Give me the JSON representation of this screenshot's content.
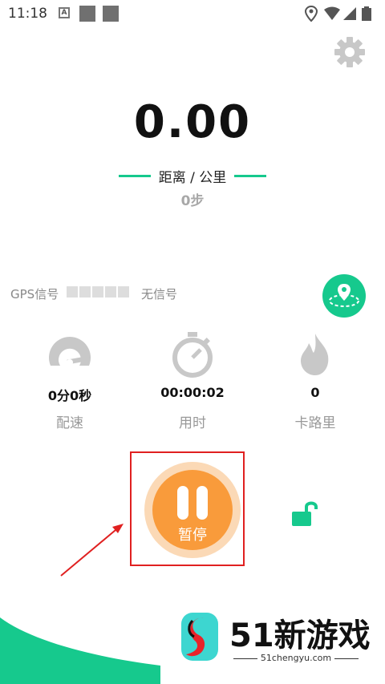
{
  "statusbar": {
    "time": "11:18",
    "a_badge": "A",
    "icons": [
      "location-icon",
      "wifi-icon",
      "signal-icon",
      "battery-icon"
    ]
  },
  "run": {
    "distance": "0.00",
    "distance_unit": "距离 / 公里",
    "steps": "0步"
  },
  "gps": {
    "label": "GPS信号",
    "signal_level": 0,
    "signal_bars_total": 5,
    "status": "无信号"
  },
  "stats": [
    {
      "value": "0分0秒",
      "label": "配速",
      "icon": "speedometer-icon"
    },
    {
      "value": "00:00:02",
      "label": "用时",
      "icon": "stopwatch-icon"
    },
    {
      "value": "0",
      "label": "卡路里",
      "icon": "flame-icon"
    }
  ],
  "controls": {
    "pause_label": "暂停",
    "lock_icon": "unlocked-icon"
  },
  "watermark": {
    "brand": "51新游戏",
    "url": "51chengyu.com"
  },
  "colors": {
    "accent": "#16c98d",
    "pause": "#f99b3b",
    "pause_ring": "#fbd9b6",
    "highlight": "#e02020",
    "icon_gray": "#c8c8c8"
  }
}
